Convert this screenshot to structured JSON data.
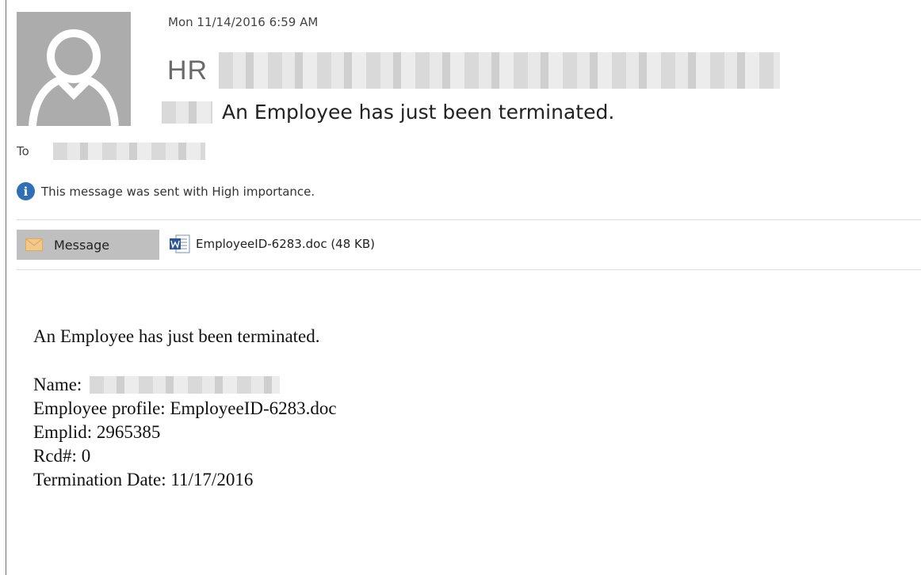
{
  "header": {
    "sent_date": "Mon 11/14/2016 6:59 AM",
    "sender_name": "HR",
    "subject": "An Employee has just been terminated.",
    "to_label": "To",
    "importance_notice": "This message was sent with High importance."
  },
  "attachments_bar": {
    "message_tab_label": "Message",
    "attachment_label": "EmployeeID-6283.doc (48 KB)"
  },
  "body": {
    "intro": "An Employee has just been terminated.",
    "name_label": "Name:",
    "profile_line": "Employee profile: EmployeeID-6283.doc",
    "emplid_line": "Emplid: 2965385",
    "rcd_line": "Rcd#: 0",
    "termination_line": "Termination Date: 11/17/2016"
  },
  "icons": {
    "avatar": "person-silhouette-icon",
    "importance": "info-icon",
    "message_tab": "envelope-icon",
    "attachment": "word-document-icon"
  },
  "colors": {
    "avatar_background": "#acacac",
    "info_icon": "#2f6fb5",
    "message_tab_background": "#bfbfbf",
    "envelope": "#f3c98b",
    "word_blue": "#2b579a"
  }
}
